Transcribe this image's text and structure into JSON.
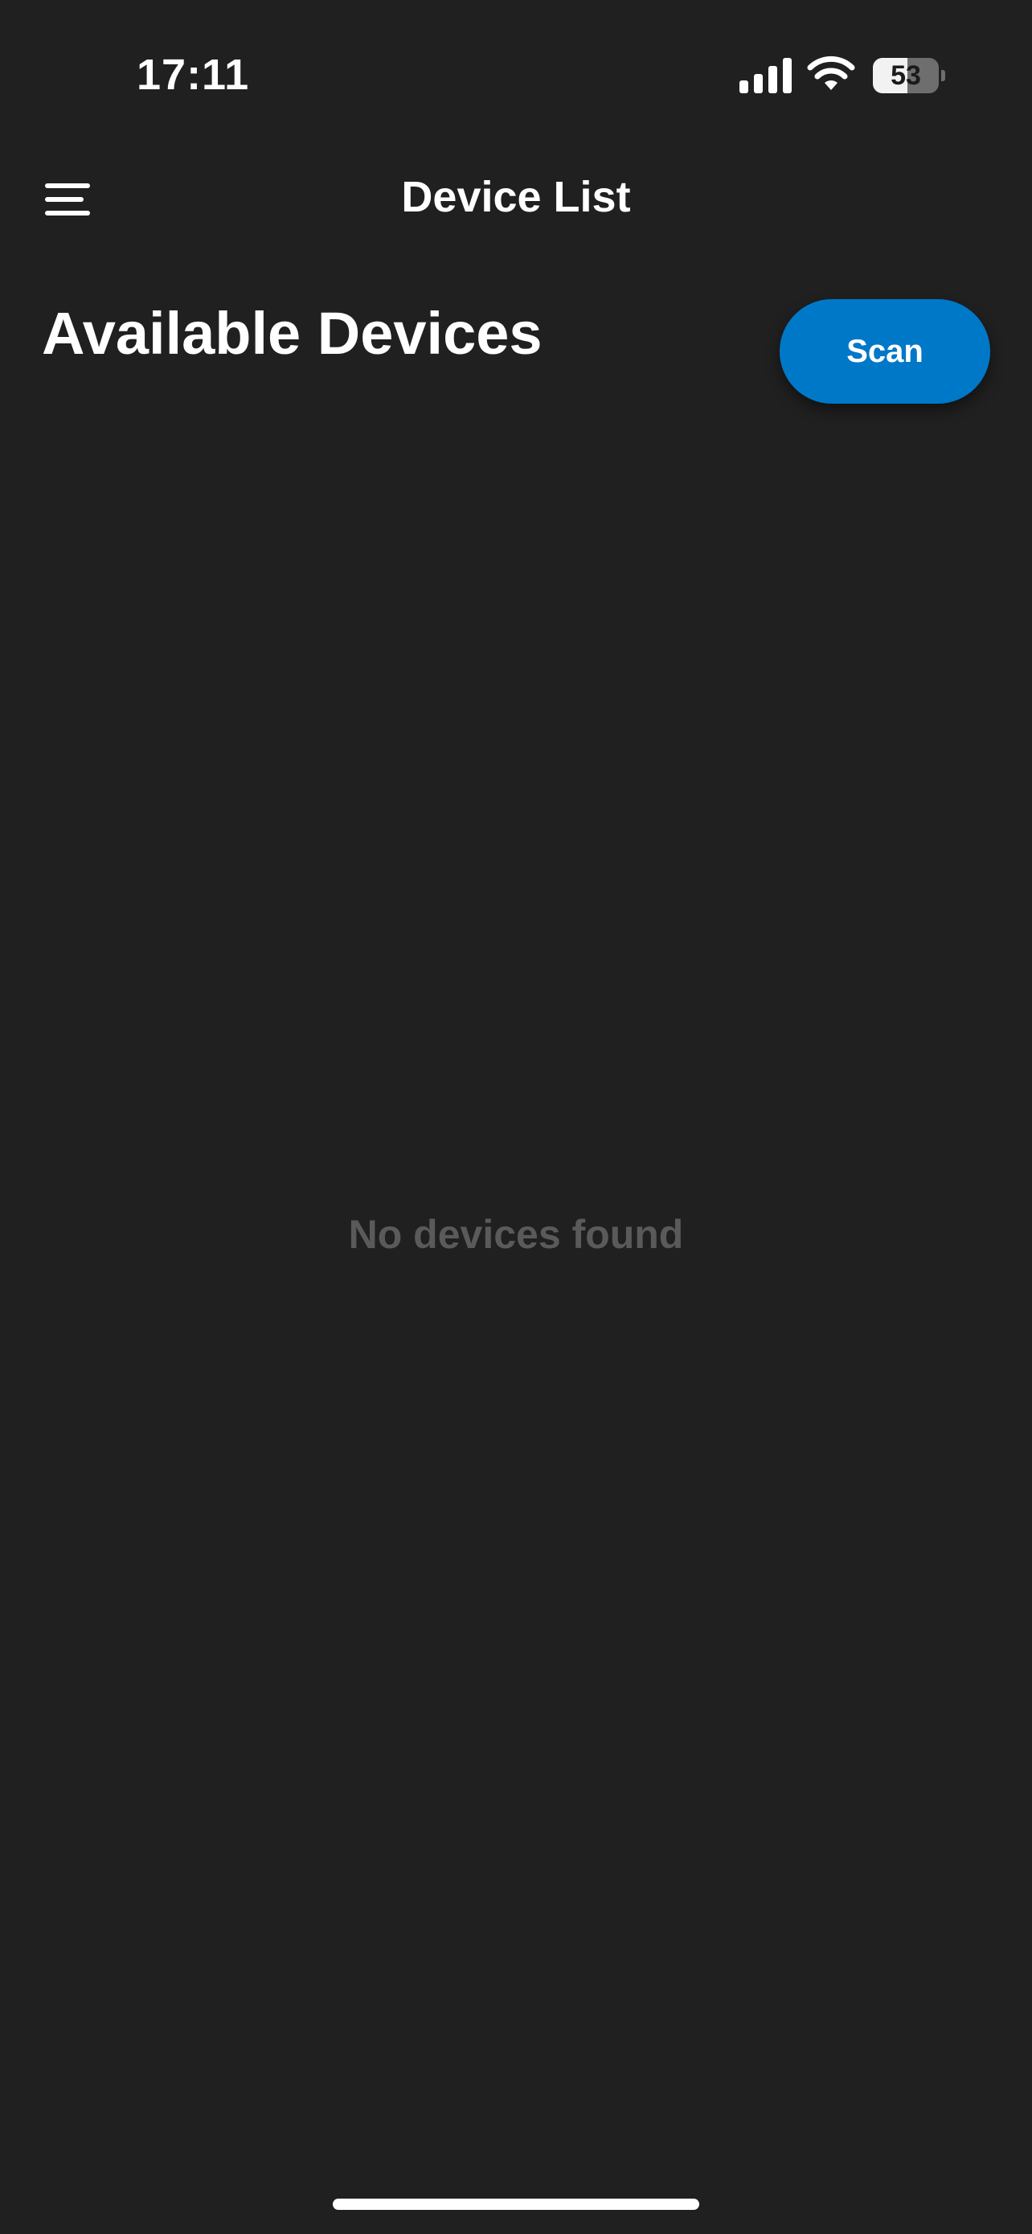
{
  "status_bar": {
    "time": "17:11",
    "battery_level": "53",
    "battery_fraction": 0.53,
    "signal_icon": "cellular-signal-icon",
    "wifi_icon": "wifi-icon"
  },
  "nav": {
    "title": "Device List",
    "menu_icon": "hamburger-menu-icon"
  },
  "main": {
    "section_title": "Available Devices",
    "scan_label": "Scan",
    "empty_message": "No devices found"
  },
  "colors": {
    "background": "#202020",
    "accent": "#0078c8",
    "empty_text": "#5a5a5a"
  }
}
